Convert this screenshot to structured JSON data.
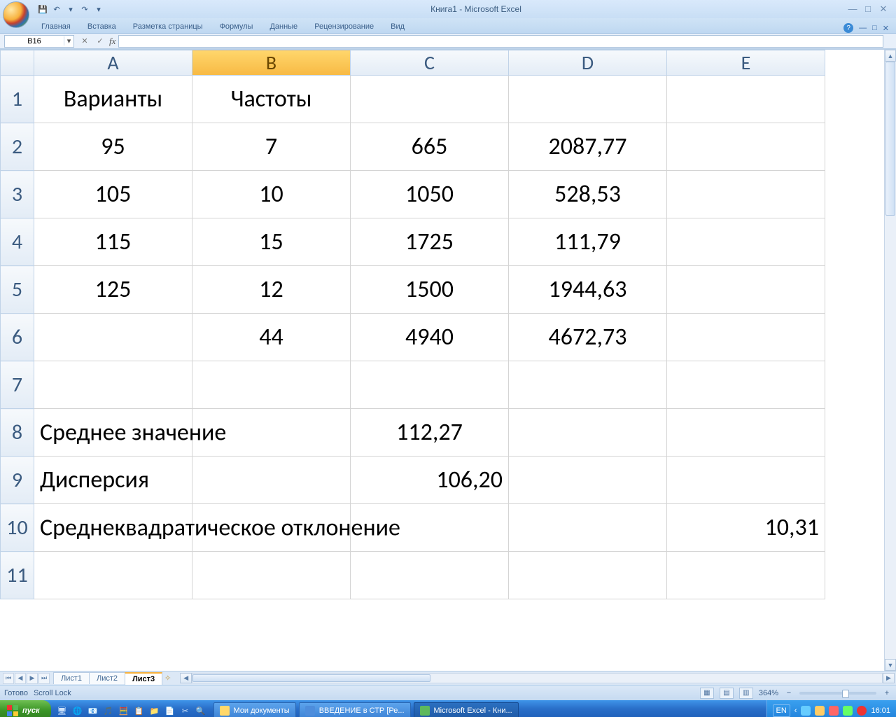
{
  "window": {
    "title": "Книга1 - Microsoft Excel",
    "namebox": "B16"
  },
  "qat": {
    "save": "💾",
    "undo": "↶",
    "redo": "↷",
    "dd": "▾"
  },
  "ribbon": {
    "tabs": [
      "Главная",
      "Вставка",
      "Разметка страницы",
      "Формулы",
      "Данные",
      "Рецензирование",
      "Вид"
    ]
  },
  "columns": [
    "A",
    "B",
    "C",
    "D",
    "E"
  ],
  "rows": [
    "1",
    "2",
    "3",
    "4",
    "5",
    "6",
    "7",
    "8",
    "9",
    "10",
    "11"
  ],
  "cells": {
    "A1": "Варианты",
    "B1": "Частоты",
    "A2": "95",
    "B2": "7",
    "C2": "665",
    "D2": "2087,77",
    "A3": "105",
    "B3": "10",
    "C3": "1050",
    "D3": "528,53",
    "A4": "115",
    "B4": "15",
    "C4": "1725",
    "D4": "111,79",
    "A5": "125",
    "B5": "12",
    "C5": "1500",
    "D5": "1944,63",
    "B6": "44",
    "C6": "4940",
    "D6": "4672,73",
    "A8": "Среднее значение",
    "C8": "112,27",
    "A9": "Дисперсия",
    "C9": "106,20",
    "A10": "Среднеквадратическое отклонение",
    "E10": "10,31"
  },
  "sheets": {
    "tabs": [
      "Лист1",
      "Лист2",
      "Лист3"
    ],
    "active": 2
  },
  "status": {
    "ready": "Готово",
    "scroll": "Scroll Lock",
    "zoom": "364%"
  },
  "taskbar": {
    "start": "пуск",
    "items": [
      {
        "label": "Мои документы",
        "cls": "fld"
      },
      {
        "label": "ВВЕДЕНИЕ в СТР [Ре...",
        "cls": "wrd"
      },
      {
        "label": "Microsoft Excel - Кни...",
        "cls": "xls",
        "active": true
      }
    ],
    "lang": "EN",
    "clock": "16:01"
  }
}
